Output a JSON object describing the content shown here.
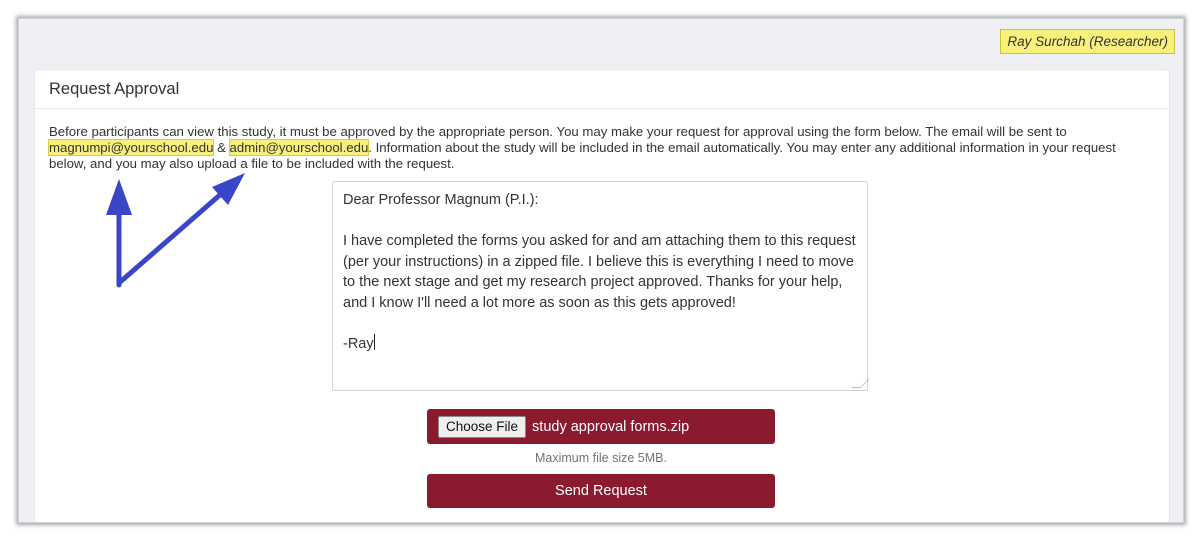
{
  "header": {
    "user_label": "Ray Surchah (Researcher)"
  },
  "card": {
    "title": "Request Approval",
    "intro": {
      "part1": "Before participants can view this study, it must be approved by the appropriate person. You may make your request for approval using the form below. The email will be sent to ",
      "email1": "magnumpi@yourschool.edu",
      "amp": " & ",
      "email2": "admin@yourschool.edu",
      "part2": ". Information about the study will be included in the email automatically. You may enter any additional information in your request below, and you may also upload a file to be included with the request."
    }
  },
  "form": {
    "message": "Dear Professor Magnum (P.I.):\n\nI have completed the forms you asked for and am attaching them to this request (per your instructions) in a zipped file. I believe this is everything I need to move to the next stage and get my research project approved. Thanks for your help, and I know I'll need a lot more as soon as this gets approved!\n\n-Ray",
    "choose_file_label": "Choose File",
    "file_name": "study approval forms.zip",
    "file_note": "Maximum file size 5MB.",
    "send_label": "Send Request"
  },
  "colors": {
    "accent": "#8b1a2e",
    "highlight": "#f7f17c",
    "arrow": "#3a46c8"
  }
}
